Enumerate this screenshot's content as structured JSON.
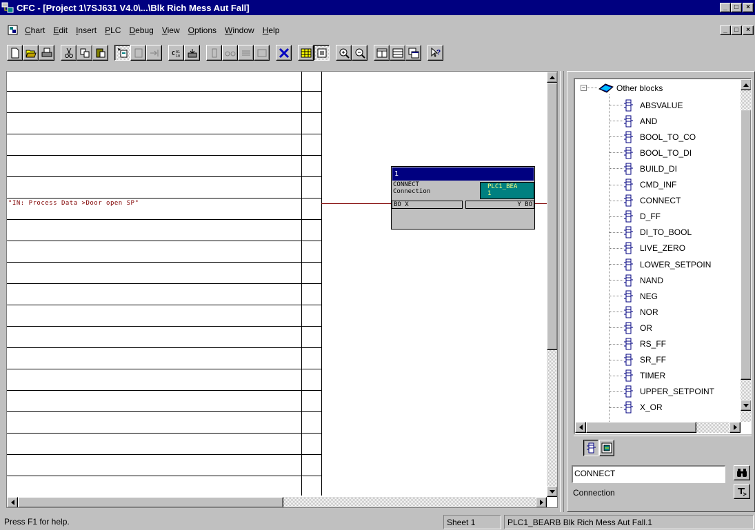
{
  "window": {
    "title": "CFC - [Project 1\\7SJ631 V4.0\\...\\Blk Rich Mess Aut Fall]",
    "caption_min": "_",
    "caption_max": "□",
    "caption_close": "×"
  },
  "menu": {
    "items": [
      "Chart",
      "Edit",
      "Insert",
      "PLC",
      "Debug",
      "View",
      "Options",
      "Window",
      "Help"
    ]
  },
  "chart": {
    "signal_label": "\"IN: Process Data >Door open SP\"",
    "wire_color": "#800000",
    "block": {
      "number": "1",
      "type_line1": "CONNECT",
      "type_line2": "Connection",
      "tag_line1": "PLC1_BEA",
      "tag_line2": "1",
      "pin_in": "BO X",
      "pin_out": "Y BO"
    }
  },
  "library": {
    "root": "Other blocks",
    "items": [
      "ABSVALUE",
      "AND",
      "BOOL_TO_CO",
      "BOOL_TO_DI",
      "BUILD_DI",
      "CMD_INF",
      "CONNECT",
      "D_FF",
      "DI_TO_BOOL",
      "LIVE_ZERO",
      "LOWER_SETPOIN",
      "NAND",
      "NEG",
      "NOR",
      "OR",
      "RS_FF",
      "SR_FF",
      "TIMER",
      "UPPER_SETPOINT",
      "X_OR"
    ],
    "search_value": "CONNECT",
    "description": "Connection"
  },
  "statusbar": {
    "help": "Press F1 for help.",
    "sheet": "Sheet 1",
    "info": "PLC1_BEARB  Blk Rich Mess Aut Fall.1"
  },
  "colors": {
    "titlebar": "#000080",
    "block_header": "#000080",
    "block_tag_bg": "#008080",
    "tree_icon": "#000080"
  }
}
